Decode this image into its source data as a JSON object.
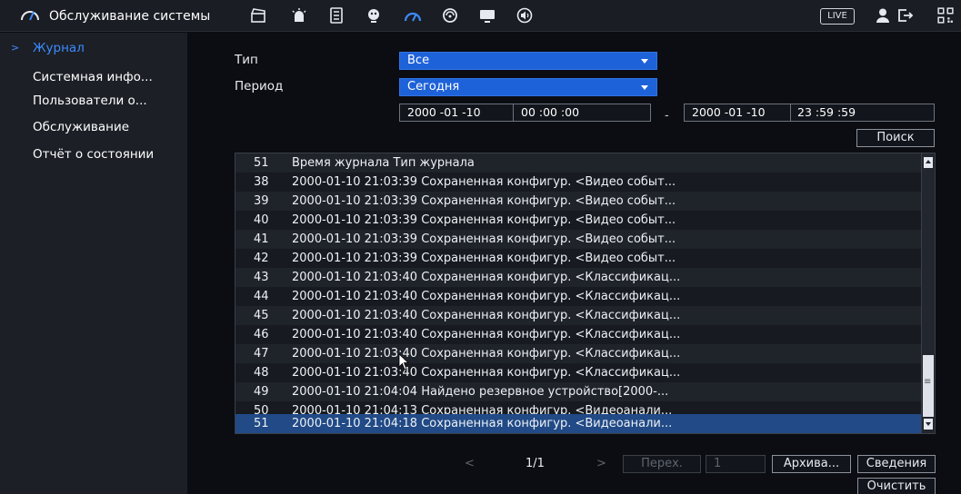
{
  "header": {
    "title": "Обслуживание системы",
    "live_label": "LIVE",
    "icons": [
      "gauge-icon",
      "clapperboard-icon",
      "alarm-light-icon",
      "hdd-icon",
      "face-icon",
      "speed-gauge-icon",
      "network-icon",
      "monitor-icon",
      "audio-icon",
      "user-icon",
      "logout-icon",
      "qr-icon"
    ]
  },
  "sidebar": {
    "items": [
      {
        "label": "Журнал",
        "active": true
      },
      {
        "label": "Системная инфо..."
      },
      {
        "label": "Пользователи о..."
      },
      {
        "label": "Обслуживание"
      },
      {
        "label": "Отчёт о состоянии"
      }
    ]
  },
  "filters": {
    "type_label": "Тип",
    "type_value": "Все",
    "period_label": "Период",
    "period_value": "Сегодня",
    "start_date": "2000 -01 -10",
    "start_time": "00 :00 :00",
    "end_date": "2000 -01 -10",
    "end_time": "23 :59 :59",
    "range_separator": "-",
    "search_label": "Поиск"
  },
  "table": {
    "header": {
      "num": "51",
      "text": "Время журнала Тип журнала"
    },
    "rows": [
      {
        "num": "38",
        "text": "2000-01-10 21:03:39 Сохраненная конфигур. <Видео событ..."
      },
      {
        "num": "39",
        "text": "2000-01-10 21:03:39 Сохраненная конфигур. <Видео событ..."
      },
      {
        "num": "40",
        "text": "2000-01-10 21:03:39 Сохраненная конфигур. <Видео событ..."
      },
      {
        "num": "41",
        "text": "2000-01-10 21:03:39 Сохраненная конфигур. <Видео событ..."
      },
      {
        "num": "42",
        "text": "2000-01-10 21:03:39 Сохраненная конфигур. <Видео событ..."
      },
      {
        "num": "43",
        "text": "2000-01-10 21:03:40 Сохраненная конфигур. <Классификац..."
      },
      {
        "num": "44",
        "text": "2000-01-10 21:03:40 Сохраненная конфигур. <Классификац..."
      },
      {
        "num": "45",
        "text": "2000-01-10 21:03:40 Сохраненная конфигур. <Классификац..."
      },
      {
        "num": "46",
        "text": "2000-01-10 21:03:40 Сохраненная конфигур. <Классификац..."
      },
      {
        "num": "47",
        "text": "2000-01-10 21:03:40 Сохраненная конфигур. <Классификац..."
      },
      {
        "num": "48",
        "text": "2000-01-10 21:03:40 Сохраненная конфигур. <Классификац..."
      },
      {
        "num": "49",
        "text": "2000-01-10 21:04:04 Найдено резервное устройство[2000-..."
      },
      {
        "num": "50",
        "text": "2000-01-10 21:04:13 Сохраненная конфигур. <Видеоанали..."
      },
      {
        "num": "51",
        "text": "2000-01-10 21:04:18 Сохраненная конфигур. <Видеоанали...",
        "selected": true
      }
    ]
  },
  "pagination": {
    "prev": "<",
    "page": "1/1",
    "next": ">",
    "goto_label": "Перех.",
    "goto_value": "1",
    "archive_label": "Архива...",
    "details_label": "Сведения",
    "clear_label": "Очистить"
  },
  "colors": {
    "accent": "#3b8bff",
    "select_bg": "#1e62d9",
    "selected_row": "#214a86"
  }
}
